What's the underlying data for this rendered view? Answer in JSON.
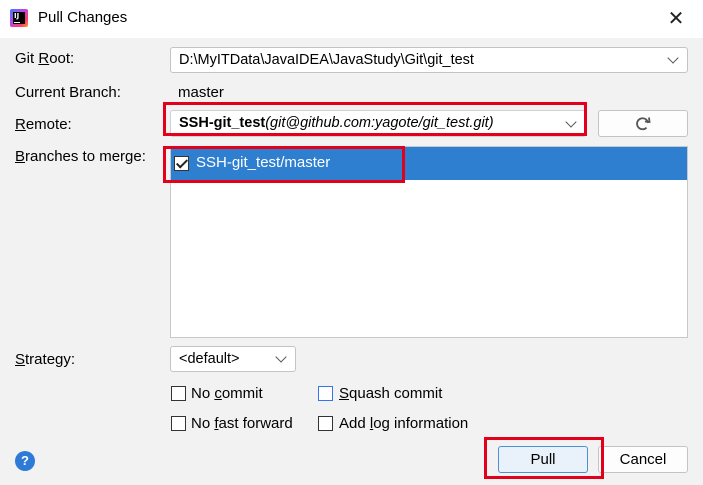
{
  "window": {
    "title": "Pull Changes",
    "close_glyph": "✕",
    "app_icon": "intellij-idea-icon"
  },
  "form": {
    "git_root": {
      "label_pre": "Git ",
      "label_mn": "R",
      "label_post": "oot:",
      "value": "D:\\MyITData\\JavaIDEA\\JavaStudy\\Git\\git_test"
    },
    "current_branch": {
      "label": "Current Branch:",
      "value": "master"
    },
    "remote": {
      "label_mn": "R",
      "label_post": "emote:",
      "name": "SSH-git_test",
      "url": "(git@github.com:yagote/git_test.git)"
    },
    "branches": {
      "label_mn": "B",
      "label_post": "ranches to merge:",
      "items": [
        {
          "label": "SSH-git_test/master",
          "checked": true
        }
      ]
    },
    "strategy": {
      "label_mn": "S",
      "label_post": "trategy:",
      "value": "<default>"
    }
  },
  "options": {
    "no_commit": {
      "pre": "No ",
      "mn": "c",
      "post": "ommit",
      "checked": false
    },
    "squash_commit": {
      "pre": "",
      "mn": "S",
      "post": "quash commit",
      "checked": false
    },
    "no_fast_forward": {
      "pre": "No ",
      "mn": "f",
      "post": "ast forward",
      "checked": false
    },
    "add_log": {
      "pre": "Add ",
      "mn": "l",
      "post": "og information",
      "checked": false
    }
  },
  "buttons": {
    "refresh_icon": "refresh-icon",
    "pull": "Pull",
    "cancel": "Cancel",
    "help": "?"
  },
  "colors": {
    "accent": "#2f7fd0",
    "highlight": "#e3001b"
  }
}
